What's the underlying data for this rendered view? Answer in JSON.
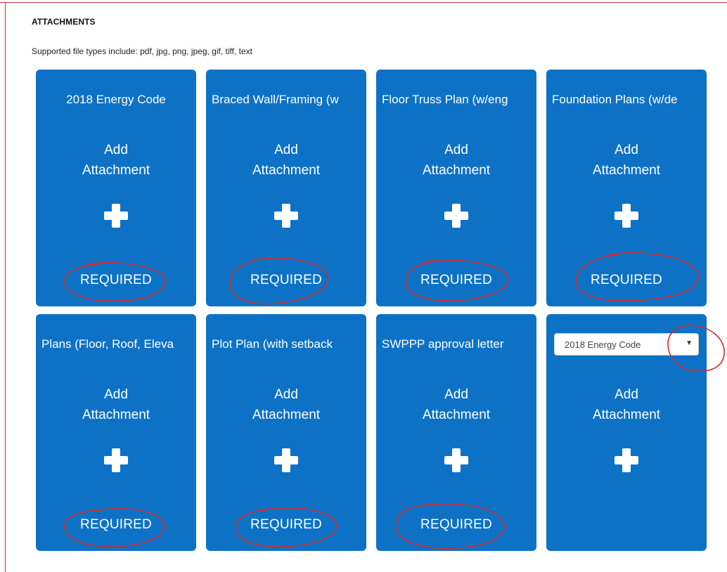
{
  "section": {
    "title": "ATTACHMENTS",
    "supported_text": "Supported file types include: pdf, jpg, png, jpeg, gif, tiff, text"
  },
  "cards": [
    {
      "title": "2018 Energy Code",
      "add_line1": "Add",
      "add_line2": "Attachment",
      "required": "REQUIRED"
    },
    {
      "title": "Braced Wall/Framing (w",
      "add_line1": "Add",
      "add_line2": "Attachment",
      "required": "REQUIRED"
    },
    {
      "title": "Floor Truss Plan (w/eng",
      "add_line1": "Add",
      "add_line2": "Attachment",
      "required": "REQUIRED"
    },
    {
      "title": "Foundation Plans (w/de",
      "add_line1": "Add",
      "add_line2": "Attachment",
      "required": "REQUIRED"
    },
    {
      "title": "Plans (Floor, Roof, Eleva",
      "add_line1": "Add",
      "add_line2": "Attachment",
      "required": "REQUIRED"
    },
    {
      "title": "Plot Plan (with setback",
      "add_line1": "Add",
      "add_line2": "Attachment",
      "required": "REQUIRED"
    },
    {
      "title": "SWPPP approval letter",
      "add_line1": "Add",
      "add_line2": "Attachment",
      "required": "REQUIRED"
    },
    {
      "select_value": "2018 Energy Code",
      "add_line1": "Add",
      "add_line2": "Attachment"
    }
  ],
  "colors": {
    "card_bg": "#0d72c6",
    "annotation": "#d62b2b"
  },
  "icons": {
    "plus": "plus-icon",
    "dropdown": "chevron-down-icon"
  }
}
